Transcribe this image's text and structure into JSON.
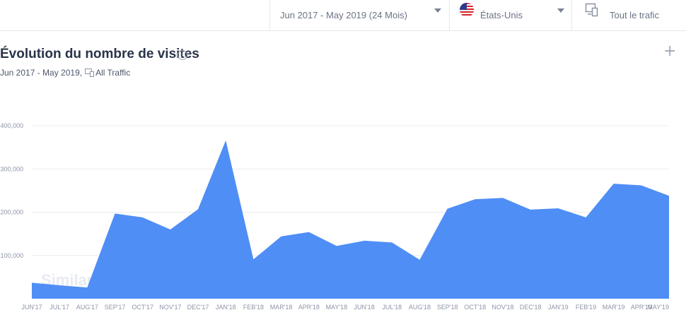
{
  "filters": {
    "date_range": "Jun 2017 - May 2019 (24 Mois)",
    "country": "États-Unis",
    "traffic": "Tout le trafic"
  },
  "card": {
    "title": "Évolution du nombre de visites",
    "subtitle_period": "Jun 2017 - May 2019,",
    "subtitle_traffic": "All Traffic",
    "watermark": "SimilarWeb"
  },
  "chart_data": {
    "type": "area",
    "title": "Évolution du nombre de visites",
    "x": [
      "JUN'17",
      "JUL'17",
      "AUG'17",
      "SEP'17",
      "OCT'17",
      "NOV'17",
      "DEC'17",
      "JAN'18",
      "FEB'18",
      "MAR'18",
      "APR'18",
      "MAY'18",
      "JUN'18",
      "JUL'18",
      "AUG'18",
      "SEP'18",
      "OCT'18",
      "NOV'18",
      "DEC'18",
      "JAN'19",
      "FEB'19",
      "MAR'19",
      "APR'19",
      "MAY'19"
    ],
    "series": [
      {
        "values": [
          37000,
          31000,
          26000,
          197000,
          188000,
          160000,
          207000,
          366000,
          91000,
          144000,
          154000,
          122000,
          134000,
          130000,
          90000,
          208000,
          230000,
          233000,
          206000,
          209000,
          188000,
          266000,
          262000,
          238000
        ],
        "color": "#4f8ef5"
      }
    ],
    "y_ticks": [
      "100,000",
      "200,000",
      "300,000",
      "400,000"
    ],
    "ylim": [
      0,
      400000
    ],
    "grid": true
  }
}
